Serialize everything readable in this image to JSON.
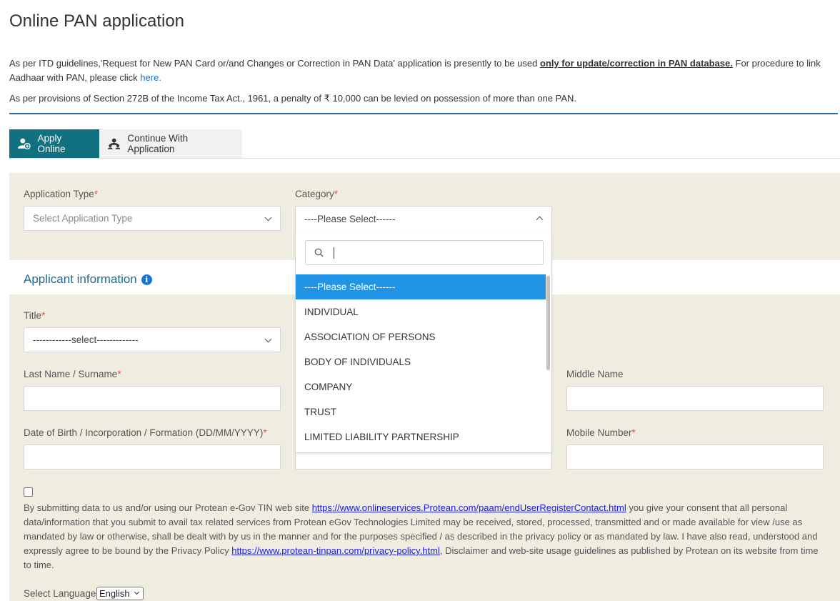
{
  "page": {
    "title": "Online PAN application"
  },
  "notices": {
    "line1_pre": "As per ITD guidelines,'Request for New PAN Card or/and Changes or Correction in PAN Data' application is presently to be used ",
    "line1_bold": "only for update/correction in PAN database.",
    "line1_post": " For procedure to link Aadhaar with PAN, please click ",
    "line1_link": "here.",
    "line2": "As per provisions of Section 272B of the Income Tax Act., 1961, a penalty of ₹ 10,000 can be levied on possession of more than one PAN."
  },
  "tabs": [
    {
      "label": "Apply Online",
      "active": true,
      "icon": "user-add-icon"
    },
    {
      "label": "Continue With Application",
      "active": false,
      "icon": "user-group-icon"
    }
  ],
  "form": {
    "application_type": {
      "label": "Application Type",
      "placeholder": "Select Application Type"
    },
    "category": {
      "label": "Category",
      "value": "----Please Select------"
    },
    "section_title": "Applicant information",
    "title_field": {
      "label": "Title",
      "value": "------------select-------------"
    },
    "last_name": {
      "label": "Last Name / Surname"
    },
    "middle_name": {
      "label": "Middle Name"
    },
    "dob": {
      "label": "Date of Birth / Incorporation / Formation (DD/MM/YYYY)"
    },
    "mobile": {
      "label": "Mobile Number"
    },
    "required_marker": "*"
  },
  "dropdown": {
    "search_value": "",
    "options": [
      "----Please Select------",
      "INDIVIDUAL",
      "ASSOCIATION OF PERSONS",
      "BODY OF INDIVIDUALS",
      "COMPANY",
      "TRUST",
      "LIMITED LIABILITY PARTNERSHIP"
    ],
    "selected_index": 0
  },
  "consent": {
    "checked": false,
    "text1": "By submitting data to us and/or using our Protean e-Gov TIN web site ",
    "link1": "https://www.onlineservices.Protean.com/paam/endUserRegisterContact.html",
    "text2": " you give your consent that all personal data/information that you submit to avail tax related services from Protean eGov Technologies Limited may be received, stored, processed, transmitted and or made available for view /use as mandated by law or otherwise, shall be dealt with by us in the manner and for the purposes specified / as described in the privacy policy or as mandated by law. I have also read, understood and expressly agree to be bound by the Privacy Policy ",
    "link2": "https://www.protean-tinpan.com/privacy-policy.html",
    "text3": ", Disclaimer and web-site usage guidelines as published by Protean on its website from time to time."
  },
  "language": {
    "label": "Select Language",
    "value": "English"
  },
  "colors": {
    "tab_active": "#127181",
    "panel_bg": "#eeede0",
    "selected_option": "#2194e6",
    "section_title": "#1d6b8e",
    "rule": "#2a6c9a"
  }
}
